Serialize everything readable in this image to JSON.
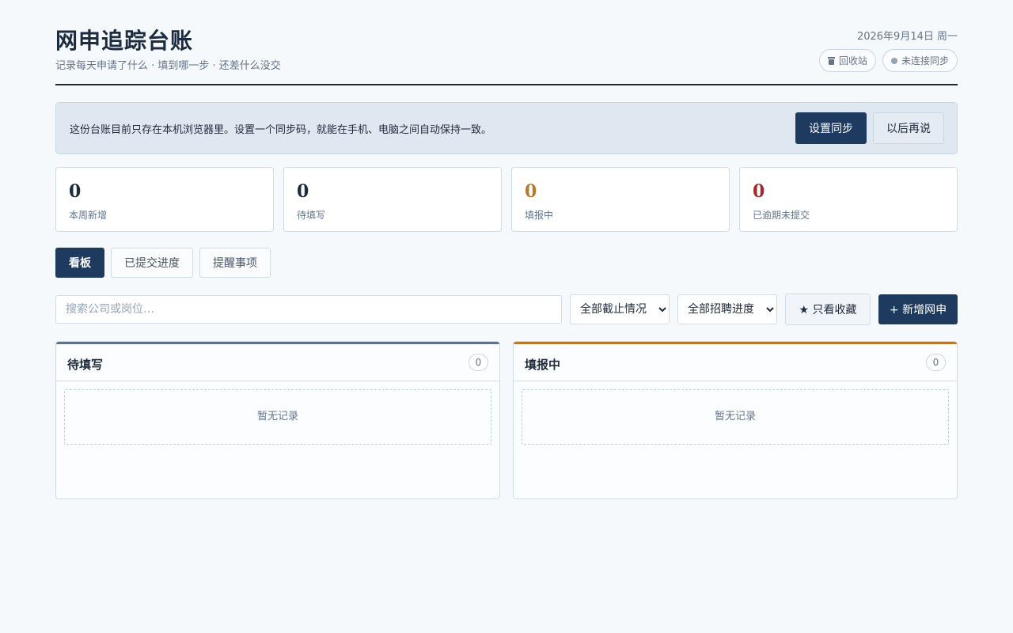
{
  "header": {
    "title": "网申追踪台账",
    "subtitle": "记录每天申请了什么 · 填到哪一步 · 还差什么没交",
    "date": "2026年9月14日 周一",
    "recycle_label": "回收站",
    "sync_status_label": "未连接同步"
  },
  "banner": {
    "text": "这份台账目前只存在本机浏览器里。设置一个同步码，就能在手机、电脑之间自动保持一致。",
    "setup_label": "设置同步",
    "later_label": "以后再说"
  },
  "stats": [
    {
      "value": "0",
      "label": "本周新增",
      "color": "#1c2b40"
    },
    {
      "value": "0",
      "label": "待填写",
      "color": "#1c2b40"
    },
    {
      "value": "0",
      "label": "填报中",
      "color": "#b7792d"
    },
    {
      "value": "0",
      "label": "已逾期未提交",
      "color": "#a12a2a"
    }
  ],
  "tabs": [
    {
      "label": "看板",
      "active": true
    },
    {
      "label": "已提交进度",
      "active": false
    },
    {
      "label": "提醒事项",
      "active": false
    }
  ],
  "filters": {
    "search_placeholder": "搜索公司或岗位…",
    "deadline_selected": "全部截止情况",
    "progress_selected": "全部招聘进度",
    "favorites_label": "★ 只看收藏",
    "add_label": "+ 新增网申"
  },
  "columns": [
    {
      "title": "待填写",
      "count": "0",
      "empty_text": "暂无记录",
      "accent": "#5f7288"
    },
    {
      "title": "填报中",
      "count": "0",
      "empty_text": "暂无记录",
      "accent": "#b7792d"
    }
  ],
  "icons": {
    "recycle": "trash-icon",
    "sync_status": "status-dot-icon"
  }
}
